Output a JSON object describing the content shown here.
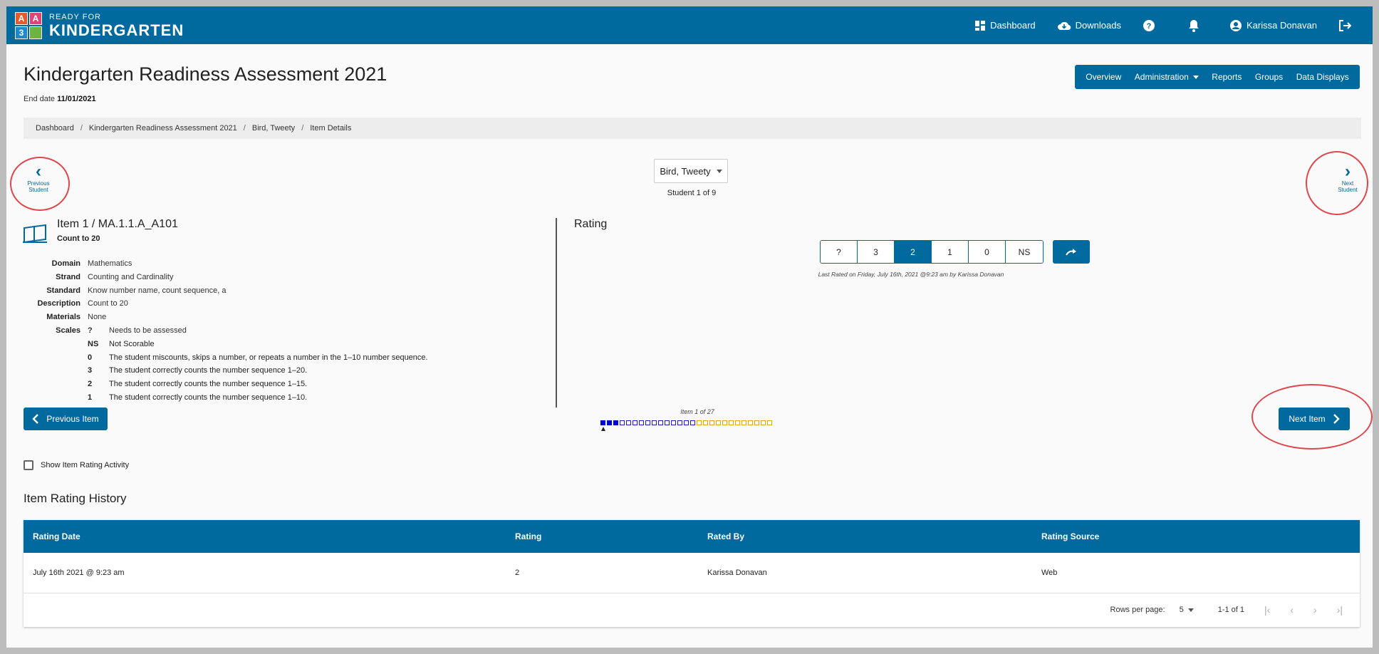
{
  "app": {
    "logo_small": "READY FOR",
    "logo_big": "KINDERGARTEN",
    "logo_tiles": [
      "A",
      "A",
      "3",
      ""
    ]
  },
  "topnav": {
    "dashboard": "Dashboard",
    "downloads": "Downloads",
    "user": "Karissa Donavan"
  },
  "header": {
    "title": "Kindergarten Readiness Assessment 2021",
    "end_date_label": "End date",
    "end_date_value": "11/01/2021"
  },
  "tabs": [
    "Overview",
    "Administration",
    "Reports",
    "Groups",
    "Data Displays"
  ],
  "breadcrumb": [
    "Dashboard",
    "Kindergarten Readiness Assessment 2021",
    "Bird, Tweety",
    "Item Details"
  ],
  "student_nav": {
    "prev_label_1": "Previous",
    "prev_label_2": "Student",
    "next_label_1": "Next",
    "next_label_2": "Student",
    "selected_student": "Bird, Tweety",
    "count": "Student 1 of 9"
  },
  "item": {
    "title": "Item 1 / MA.1.1.A_A101",
    "subtitle": "Count to 20",
    "details": [
      {
        "label": "Domain",
        "value": "Mathematics"
      },
      {
        "label": "Strand",
        "value": "Counting and Cardinality"
      },
      {
        "label": "Standard",
        "value": "Know number name, count sequence, a"
      },
      {
        "label": "Description",
        "value": "Count to 20"
      },
      {
        "label": "Materials",
        "value": "None"
      }
    ],
    "scales_label": "Scales",
    "scales": [
      {
        "code": "?",
        "text": "Needs to be assessed"
      },
      {
        "code": "NS",
        "text": "Not Scorable"
      },
      {
        "code": "0",
        "text": "The student miscounts, skips a number, or repeats a number in the 1–10 number sequence."
      },
      {
        "code": "3",
        "text": "The student correctly counts the number sequence 1–20."
      },
      {
        "code": "2",
        "text": "The student correctly counts the number sequence 1–15."
      },
      {
        "code": "1",
        "text": "The student correctly counts the number sequence 1–10."
      }
    ]
  },
  "rating": {
    "title": "Rating",
    "options": [
      "?",
      "3",
      "2",
      "1",
      "0",
      "NS"
    ],
    "selected": "2",
    "last_rated": "Last Rated on Friday, July 16th, 2021 @9:23 am by Karissa Donavan"
  },
  "item_nav": {
    "prev_label": "Previous Item",
    "next_label": "Next Item",
    "progress_label": "Item 1 of 27",
    "total_items": 27,
    "completed_items": 3,
    "blue_outline_items": 15
  },
  "activity": {
    "show_label": "Show Item Rating Activity"
  },
  "history": {
    "title": "Item Rating History",
    "columns": [
      "Rating Date",
      "Rating",
      "Rated By",
      "Rating Source"
    ],
    "rows": [
      [
        "July 16th 2021 @ 9:23 am",
        "2",
        "Karissa Donavan",
        "Web"
      ]
    ],
    "rows_per_page_label": "Rows per page:",
    "rows_per_page_value": "5",
    "range": "1-1 of 1"
  },
  "colors": {
    "primary": "#006a9e",
    "highlight_circle": "#e0474c",
    "progress_done": "#0000cc",
    "progress_pending": "#e0a800"
  }
}
